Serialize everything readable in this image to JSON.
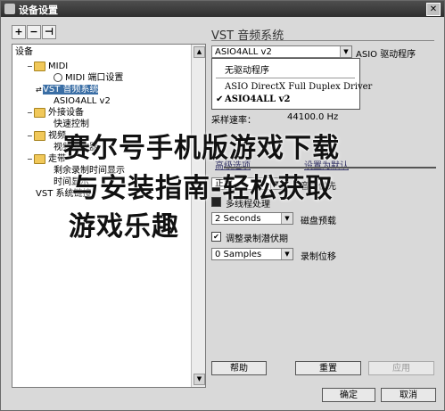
{
  "window": {
    "title": "设备设置"
  },
  "toolbar": {
    "add": "+",
    "remove": "−",
    "reset": "⊣"
  },
  "tree": {
    "header": "设备",
    "nodes": [
      {
        "label": "MIDI",
        "type": "folder"
      },
      {
        "label": "MIDI 端口设置",
        "type": "radio"
      },
      {
        "label": "VST 音频系统",
        "type": "item",
        "selected": true
      },
      {
        "label": "ASIO4ALL v2",
        "type": "item"
      },
      {
        "label": "外接设备",
        "type": "folder"
      },
      {
        "label": "快速控制",
        "type": "item"
      },
      {
        "label": "视频",
        "type": "folder"
      },
      {
        "label": "视频播放器",
        "type": "item"
      },
      {
        "label": "走带",
        "type": "folder"
      },
      {
        "label": "剩余录制时间显示",
        "type": "item"
      },
      {
        "label": "时间显示",
        "type": "item"
      },
      {
        "label": "VST 系统链接",
        "type": "item"
      }
    ]
  },
  "panel": {
    "title": "VST 音频系统",
    "driver_value": "ASIO4ALL v2",
    "driver_label": "ASIO 驱动程序",
    "menu": {
      "item0": "无驱动程序",
      "item1": "ASIO DirectX Full Duplex Driver",
      "item2": "ASIO4ALL v2",
      "checkmark": "✔"
    },
    "sample_rate_label": "采样速率：",
    "sample_rate_value": "44100.0 Hz",
    "tab_advanced": "高级选项",
    "tab_defaults": "设置为默认",
    "priority_value": "正常",
    "priority_label": "音频优先",
    "multiprocess_label": "多线程处理",
    "disk_value": "2 Seconds",
    "disk_label": "磁盘预载",
    "adjust_label": "调整录制潜伏期",
    "offset_value": "0 Samples",
    "offset_label": "录制位移"
  },
  "buttons": {
    "help": "帮助",
    "reset": "重置",
    "apply": "应用",
    "ok": "确定",
    "cancel": "取消"
  },
  "overlay": {
    "line1": "赛尔号手机版游戏下载",
    "line2": "与安装指南-轻松获取",
    "line3": "游戏乐趣"
  }
}
